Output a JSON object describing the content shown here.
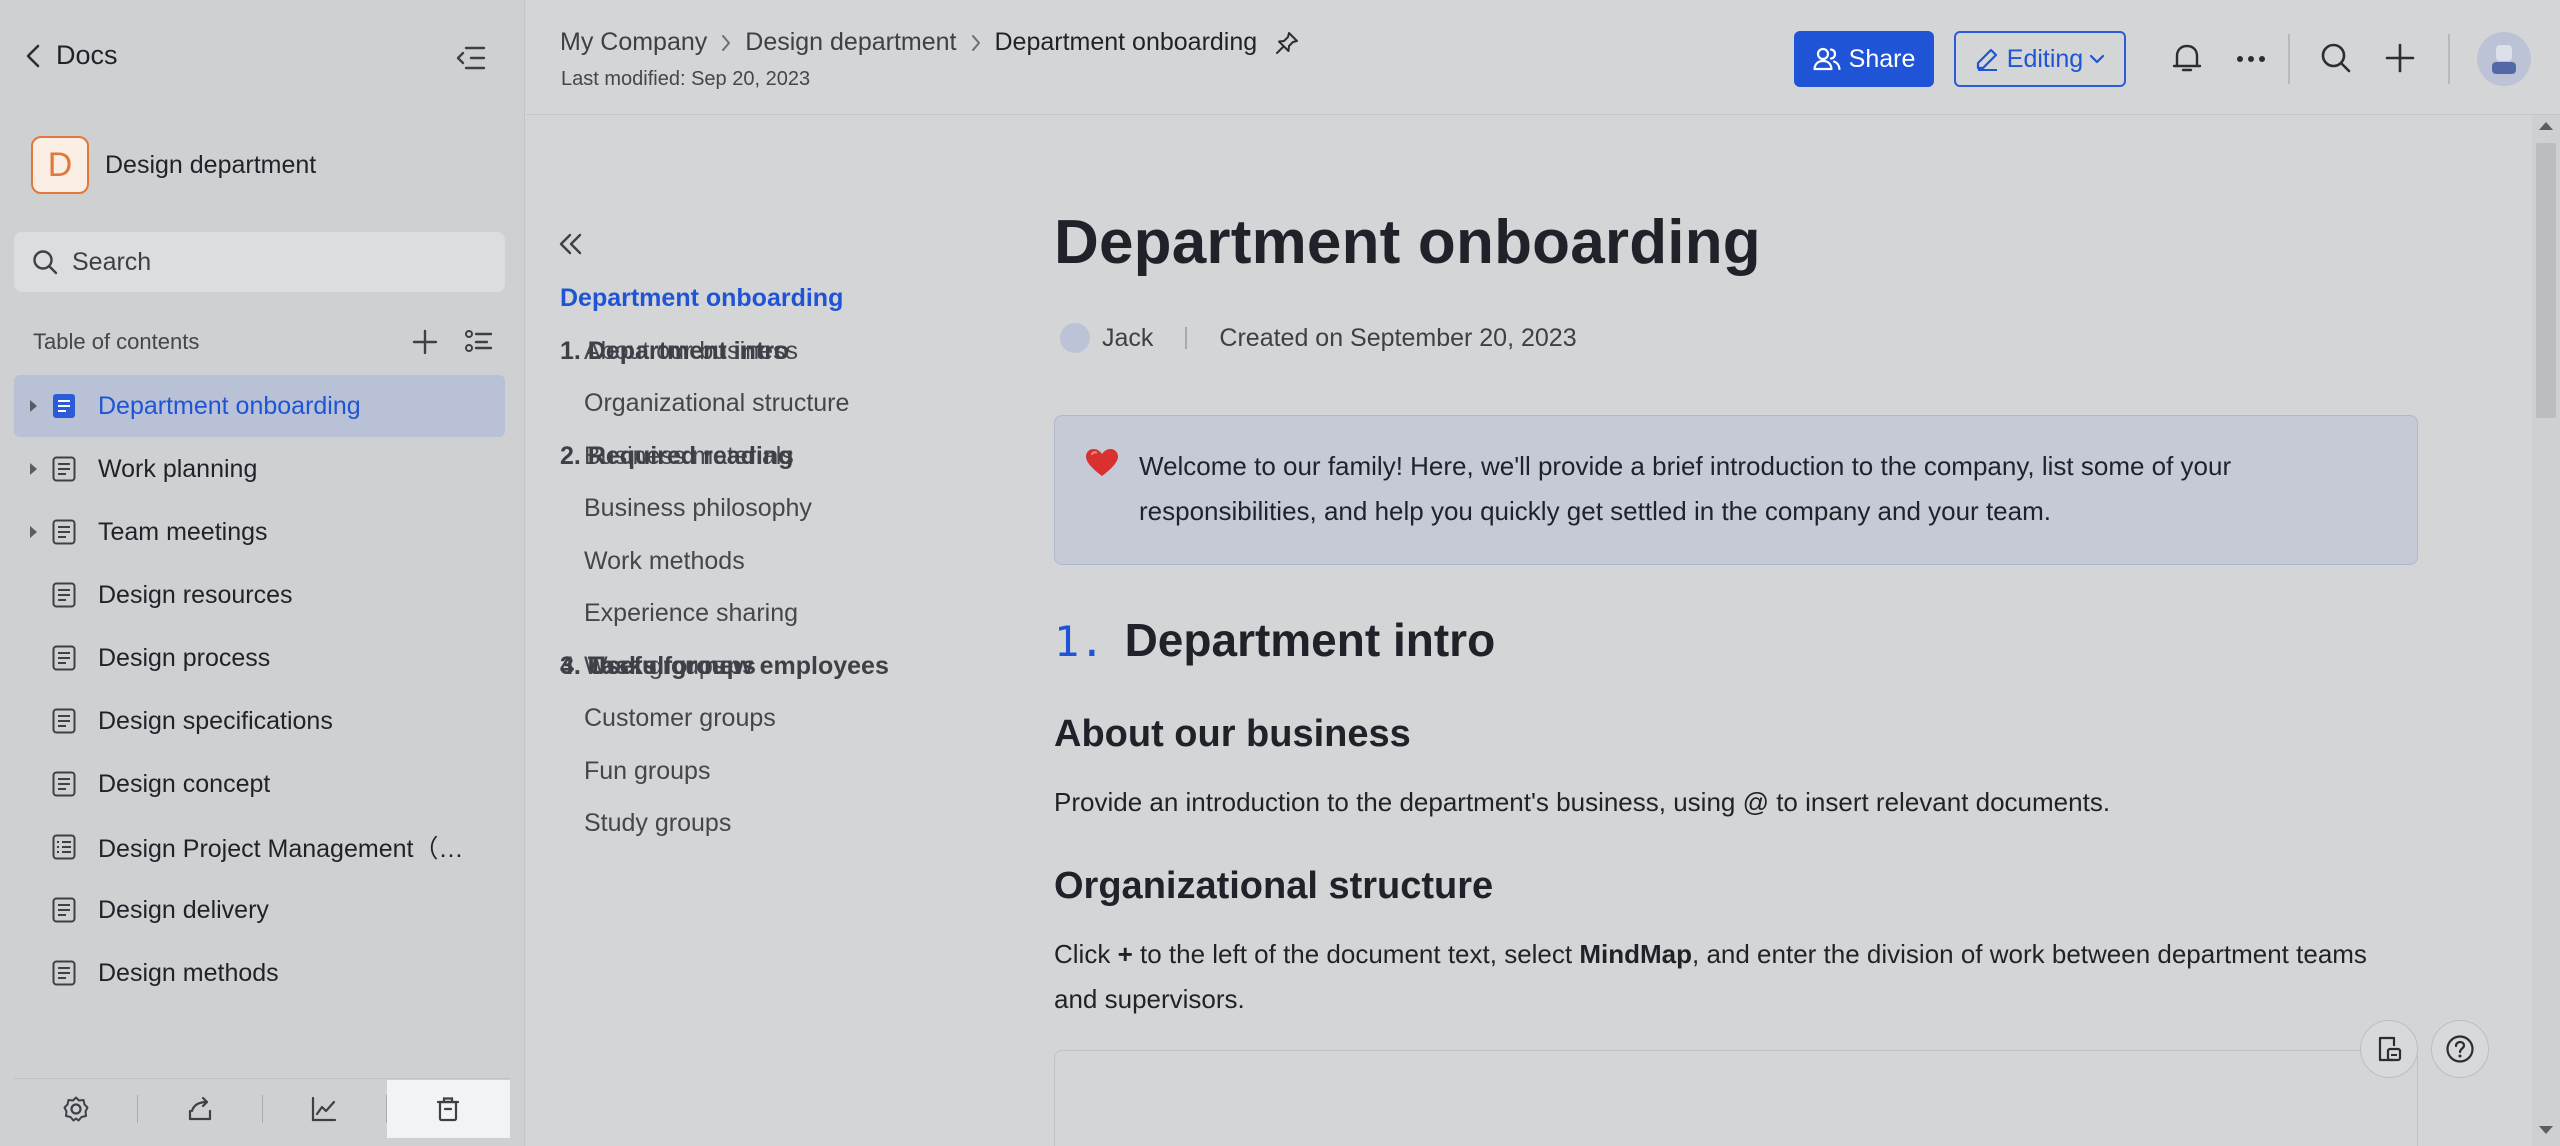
{
  "sidebar": {
    "back_label": "Docs",
    "space": {
      "initial": "D",
      "name": "Design department"
    },
    "search_placeholder": "Search",
    "toc_title": "Table of contents",
    "items": [
      {
        "label": "Department onboarding",
        "expandable": true,
        "active": true
      },
      {
        "label": "Work planning",
        "expandable": true
      },
      {
        "label": "Team meetings",
        "expandable": true
      },
      {
        "label": "Design resources"
      },
      {
        "label": "Design process"
      },
      {
        "label": "Design specifications"
      },
      {
        "label": "Design concept"
      },
      {
        "label": "Design Project Management（Da..."
      },
      {
        "label": "Design delivery"
      },
      {
        "label": "Design methods"
      }
    ]
  },
  "header": {
    "breadcrumbs": [
      "My Company",
      "Design department",
      "Department onboarding"
    ],
    "last_modified": "Last modified: Sep 20, 2023",
    "share_label": "Share",
    "editing_label": "Editing"
  },
  "outline": {
    "title": "Department onboarding",
    "items": [
      {
        "label": "1. Department intro",
        "level": 1
      },
      {
        "label": "About our business",
        "level": 2
      },
      {
        "label": "Organizational structure",
        "level": 2
      },
      {
        "label": "2. Required reading",
        "level": 1
      },
      {
        "label": "Business materials",
        "level": 2
      },
      {
        "label": "Business philosophy",
        "level": 2
      },
      {
        "label": "Work methods",
        "level": 2
      },
      {
        "label": "Experience sharing",
        "level": 2
      },
      {
        "label": "3. Tasks for new employees",
        "level": 1
      },
      {
        "label": "4. Useful groups",
        "level": 1
      },
      {
        "label": "Work groups",
        "level": 2
      },
      {
        "label": "Customer groups",
        "level": 2
      },
      {
        "label": "Fun groups",
        "level": 2
      },
      {
        "label": "Study groups",
        "level": 2
      }
    ]
  },
  "doc": {
    "title": "Department onboarding",
    "author": "Jack",
    "created": "Created on September 20, 2023",
    "callout": "Welcome to our family! Here, we'll provide a brief introduction to the company, list some of your responsibilities, and help you quickly get settled in the company and your team.",
    "section1_num": "1.",
    "section1_title": "Department intro",
    "h_business": "About our business",
    "p_business": "Provide an introduction to the department's business, using @ to insert relevant documents.",
    "h_org": "Organizational structure",
    "p_org_1": "Click ",
    "p_org_plus": "+",
    "p_org_2": " to the left of the document text, select ",
    "p_org_mind": "MindMap",
    "p_org_3": ", and enter the division of work between department teams and supervisors."
  },
  "colors": {
    "accent": "#1f54d6",
    "sidebar_bg": "#cfd0d2",
    "active_bg": "#b8c1d6",
    "callout_bg": "#c5cad6"
  }
}
